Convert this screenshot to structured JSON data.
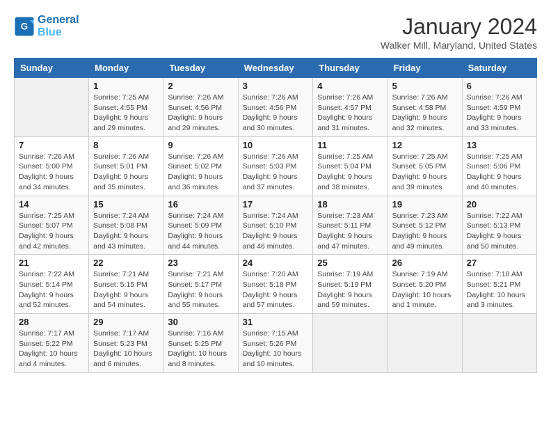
{
  "header": {
    "logo_general": "General",
    "logo_blue": "Blue",
    "month": "January 2024",
    "location": "Walker Mill, Maryland, United States"
  },
  "days_of_week": [
    "Sunday",
    "Monday",
    "Tuesday",
    "Wednesday",
    "Thursday",
    "Friday",
    "Saturday"
  ],
  "weeks": [
    [
      {
        "num": "",
        "sunrise": "",
        "sunset": "",
        "daylight": ""
      },
      {
        "num": "1",
        "sunrise": "Sunrise: 7:25 AM",
        "sunset": "Sunset: 4:55 PM",
        "daylight": "Daylight: 9 hours and 29 minutes."
      },
      {
        "num": "2",
        "sunrise": "Sunrise: 7:26 AM",
        "sunset": "Sunset: 4:56 PM",
        "daylight": "Daylight: 9 hours and 29 minutes."
      },
      {
        "num": "3",
        "sunrise": "Sunrise: 7:26 AM",
        "sunset": "Sunset: 4:56 PM",
        "daylight": "Daylight: 9 hours and 30 minutes."
      },
      {
        "num": "4",
        "sunrise": "Sunrise: 7:26 AM",
        "sunset": "Sunset: 4:57 PM",
        "daylight": "Daylight: 9 hours and 31 minutes."
      },
      {
        "num": "5",
        "sunrise": "Sunrise: 7:26 AM",
        "sunset": "Sunset: 4:58 PM",
        "daylight": "Daylight: 9 hours and 32 minutes."
      },
      {
        "num": "6",
        "sunrise": "Sunrise: 7:26 AM",
        "sunset": "Sunset: 4:59 PM",
        "daylight": "Daylight: 9 hours and 33 minutes."
      }
    ],
    [
      {
        "num": "7",
        "sunrise": "Sunrise: 7:26 AM",
        "sunset": "Sunset: 5:00 PM",
        "daylight": "Daylight: 9 hours and 34 minutes."
      },
      {
        "num": "8",
        "sunrise": "Sunrise: 7:26 AM",
        "sunset": "Sunset: 5:01 PM",
        "daylight": "Daylight: 9 hours and 35 minutes."
      },
      {
        "num": "9",
        "sunrise": "Sunrise: 7:26 AM",
        "sunset": "Sunset: 5:02 PM",
        "daylight": "Daylight: 9 hours and 36 minutes."
      },
      {
        "num": "10",
        "sunrise": "Sunrise: 7:26 AM",
        "sunset": "Sunset: 5:03 PM",
        "daylight": "Daylight: 9 hours and 37 minutes."
      },
      {
        "num": "11",
        "sunrise": "Sunrise: 7:25 AM",
        "sunset": "Sunset: 5:04 PM",
        "daylight": "Daylight: 9 hours and 38 minutes."
      },
      {
        "num": "12",
        "sunrise": "Sunrise: 7:25 AM",
        "sunset": "Sunset: 5:05 PM",
        "daylight": "Daylight: 9 hours and 39 minutes."
      },
      {
        "num": "13",
        "sunrise": "Sunrise: 7:25 AM",
        "sunset": "Sunset: 5:06 PM",
        "daylight": "Daylight: 9 hours and 40 minutes."
      }
    ],
    [
      {
        "num": "14",
        "sunrise": "Sunrise: 7:25 AM",
        "sunset": "Sunset: 5:07 PM",
        "daylight": "Daylight: 9 hours and 42 minutes."
      },
      {
        "num": "15",
        "sunrise": "Sunrise: 7:24 AM",
        "sunset": "Sunset: 5:08 PM",
        "daylight": "Daylight: 9 hours and 43 minutes."
      },
      {
        "num": "16",
        "sunrise": "Sunrise: 7:24 AM",
        "sunset": "Sunset: 5:09 PM",
        "daylight": "Daylight: 9 hours and 44 minutes."
      },
      {
        "num": "17",
        "sunrise": "Sunrise: 7:24 AM",
        "sunset": "Sunset: 5:10 PM",
        "daylight": "Daylight: 9 hours and 46 minutes."
      },
      {
        "num": "18",
        "sunrise": "Sunrise: 7:23 AM",
        "sunset": "Sunset: 5:11 PM",
        "daylight": "Daylight: 9 hours and 47 minutes."
      },
      {
        "num": "19",
        "sunrise": "Sunrise: 7:23 AM",
        "sunset": "Sunset: 5:12 PM",
        "daylight": "Daylight: 9 hours and 49 minutes."
      },
      {
        "num": "20",
        "sunrise": "Sunrise: 7:22 AM",
        "sunset": "Sunset: 5:13 PM",
        "daylight": "Daylight: 9 hours and 50 minutes."
      }
    ],
    [
      {
        "num": "21",
        "sunrise": "Sunrise: 7:22 AM",
        "sunset": "Sunset: 5:14 PM",
        "daylight": "Daylight: 9 hours and 52 minutes."
      },
      {
        "num": "22",
        "sunrise": "Sunrise: 7:21 AM",
        "sunset": "Sunset: 5:15 PM",
        "daylight": "Daylight: 9 hours and 54 minutes."
      },
      {
        "num": "23",
        "sunrise": "Sunrise: 7:21 AM",
        "sunset": "Sunset: 5:17 PM",
        "daylight": "Daylight: 9 hours and 55 minutes."
      },
      {
        "num": "24",
        "sunrise": "Sunrise: 7:20 AM",
        "sunset": "Sunset: 5:18 PM",
        "daylight": "Daylight: 9 hours and 57 minutes."
      },
      {
        "num": "25",
        "sunrise": "Sunrise: 7:19 AM",
        "sunset": "Sunset: 5:19 PM",
        "daylight": "Daylight: 9 hours and 59 minutes."
      },
      {
        "num": "26",
        "sunrise": "Sunrise: 7:19 AM",
        "sunset": "Sunset: 5:20 PM",
        "daylight": "Daylight: 10 hours and 1 minute."
      },
      {
        "num": "27",
        "sunrise": "Sunrise: 7:18 AM",
        "sunset": "Sunset: 5:21 PM",
        "daylight": "Daylight: 10 hours and 3 minutes."
      }
    ],
    [
      {
        "num": "28",
        "sunrise": "Sunrise: 7:17 AM",
        "sunset": "Sunset: 5:22 PM",
        "daylight": "Daylight: 10 hours and 4 minutes."
      },
      {
        "num": "29",
        "sunrise": "Sunrise: 7:17 AM",
        "sunset": "Sunset: 5:23 PM",
        "daylight": "Daylight: 10 hours and 6 minutes."
      },
      {
        "num": "30",
        "sunrise": "Sunrise: 7:16 AM",
        "sunset": "Sunset: 5:25 PM",
        "daylight": "Daylight: 10 hours and 8 minutes."
      },
      {
        "num": "31",
        "sunrise": "Sunrise: 7:15 AM",
        "sunset": "Sunset: 5:26 PM",
        "daylight": "Daylight: 10 hours and 10 minutes."
      },
      {
        "num": "",
        "sunrise": "",
        "sunset": "",
        "daylight": ""
      },
      {
        "num": "",
        "sunrise": "",
        "sunset": "",
        "daylight": ""
      },
      {
        "num": "",
        "sunrise": "",
        "sunset": "",
        "daylight": ""
      }
    ]
  ]
}
